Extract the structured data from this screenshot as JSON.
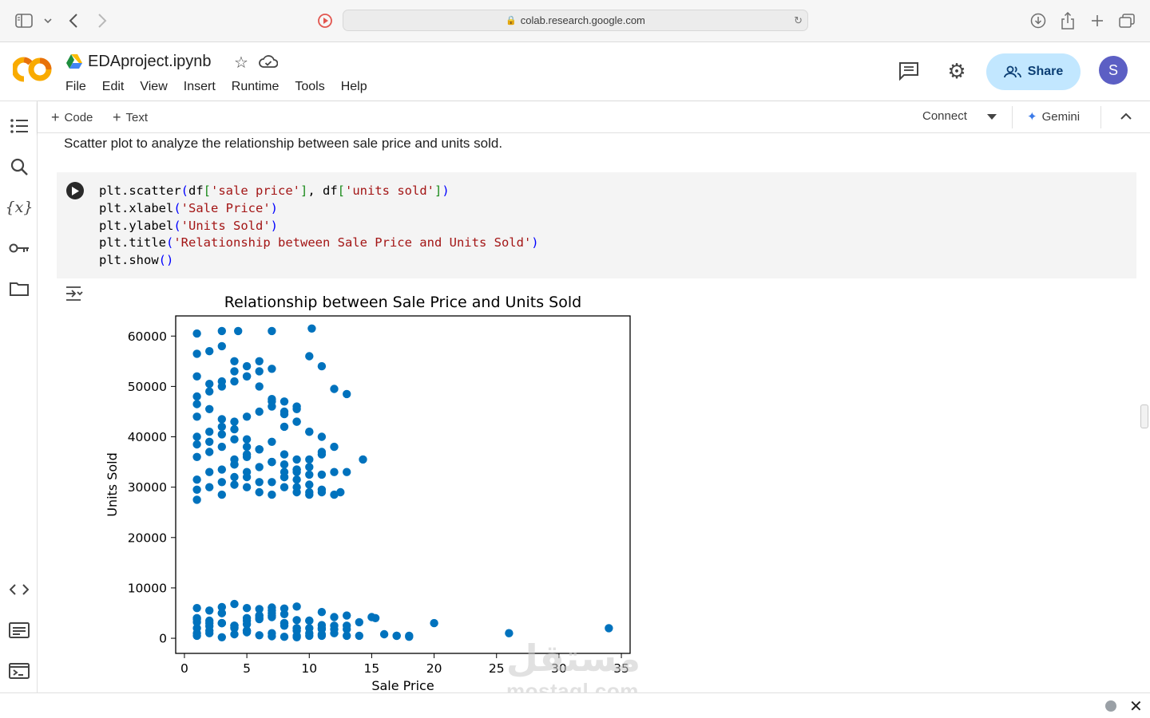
{
  "browser": {
    "url": "colab.research.google.com"
  },
  "header": {
    "notebook_title": "EDAproject.ipynb",
    "menu": [
      "File",
      "Edit",
      "View",
      "Insert",
      "Runtime",
      "Tools",
      "Help"
    ],
    "share_label": "Share",
    "avatar_initial": "S"
  },
  "toolbar": {
    "code_label": "Code",
    "text_label": "Text",
    "connect_label": "Connect",
    "gemini_label": "Gemini"
  },
  "notebook": {
    "markdown_text": "Scatter plot to analyze the relationship between sale price and units sold.",
    "code_lines": [
      "plt.scatter(df['sale price'], df['units sold'])",
      "plt.xlabel('Sale Price')",
      "plt.ylabel('Units Sold')",
      "plt.title('Relationship between Sale Price and Units Sold')",
      "plt.show()"
    ]
  },
  "watermark": {
    "latin": "mostaql.com",
    "arabic": "مستقل"
  },
  "chart_data": {
    "type": "scatter",
    "title": "Relationship between Sale Price and Units Sold",
    "xlabel": "Sale Price",
    "ylabel": "Units Sold",
    "xlim": [
      -0.7,
      35.7
    ],
    "ylim": [
      -3000,
      64000
    ],
    "xticks": [
      0,
      5,
      10,
      15,
      20,
      25,
      30,
      35
    ],
    "yticks": [
      0,
      10000,
      20000,
      30000,
      40000,
      50000,
      60000
    ],
    "grid": false,
    "color": "#0072bd",
    "x": [
      1,
      3,
      4.3,
      7,
      10.2,
      1,
      2,
      3,
      4,
      5,
      6,
      7,
      8,
      9,
      10,
      11,
      12,
      1,
      2,
      3,
      4,
      5,
      6,
      7,
      8,
      9,
      10,
      11,
      1,
      2,
      3,
      4,
      5,
      6,
      7,
      8,
      9,
      10,
      11,
      12,
      13,
      14.3,
      1,
      2,
      3,
      4,
      5,
      6,
      7,
      8,
      9,
      1,
      2,
      3,
      4,
      5,
      6,
      7,
      8,
      9,
      10,
      11,
      12,
      13,
      1,
      2,
      3,
      4,
      5,
      6,
      7,
      8,
      9,
      10,
      12,
      1,
      2,
      3,
      4,
      5,
      6,
      7,
      8,
      9,
      10,
      11,
      1,
      3,
      4,
      5,
      6,
      7,
      8,
      9,
      10,
      11,
      12.5,
      1,
      2,
      3,
      4,
      5,
      7,
      8,
      9,
      10,
      1,
      3,
      4,
      5,
      6,
      7,
      9,
      10,
      11,
      1,
      2,
      4,
      5,
      6,
      8,
      9,
      1,
      2,
      3,
      4,
      5,
      6,
      7,
      8,
      9,
      1,
      2,
      3,
      4,
      5,
      6,
      7,
      8,
      9,
      10,
      11,
      12,
      13,
      14,
      15,
      16,
      17,
      18,
      1,
      2,
      3,
      4,
      5,
      6,
      7,
      8,
      9,
      10,
      11,
      12,
      13,
      1,
      2,
      3,
      4,
      5,
      6,
      7,
      8,
      9,
      10,
      11,
      1,
      2,
      3,
      4,
      5,
      6,
      7,
      8,
      9,
      10,
      11,
      12,
      13,
      1,
      2,
      3,
      4,
      5,
      6,
      7,
      8,
      9,
      10,
      11,
      12,
      1,
      3,
      5,
      7,
      9,
      11,
      13,
      15.3,
      20,
      34,
      26,
      18,
      17,
      14
    ],
    "y": [
      60500,
      61000,
      61000,
      61000,
      61500,
      29500,
      30000,
      31000,
      32000,
      33000,
      34000,
      35000,
      30000,
      29000,
      28500,
      29000,
      28500,
      36000,
      37000,
      38000,
      35500,
      36500,
      37500,
      35000,
      34500,
      33500,
      32500,
      37000,
      40000,
      41000,
      42000,
      43000,
      44000,
      45000,
      46000,
      42000,
      43000,
      41000,
      40000,
      38000,
      33000,
      35500,
      48000,
      49000,
      50000,
      51000,
      52000,
      53000,
      53500,
      47000,
      46000,
      52000,
      50500,
      51000,
      53000,
      54000,
      55000,
      47500,
      44500,
      45500,
      56000,
      54000,
      49500,
      48500,
      56500,
      57000,
      58000,
      55000,
      52000,
      50000,
      47000,
      45000,
      43000,
      41000,
      33000,
      38500,
      39000,
      40500,
      39500,
      38000,
      37500,
      39000,
      36500,
      35500,
      34000,
      32500,
      46500,
      43500,
      41500,
      39500,
      37500,
      35000,
      33000,
      31500,
      30500,
      29500,
      29000,
      44000,
      45500,
      33500,
      34500,
      36000,
      31000,
      32000,
      30000,
      29000,
      31500,
      28500,
      30500,
      32000,
      29000,
      28500,
      33500,
      35500,
      36500,
      27500,
      33000,
      34500,
      30000,
      31000,
      32000,
      33000,
      6000,
      5500,
      6200,
      6800,
      6000,
      5800,
      6100,
      5900,
      6300,
      2000,
      1500,
      3000,
      2500,
      3500,
      4000,
      4500,
      3000,
      2000,
      1000,
      500,
      2500,
      1800,
      3200,
      4200,
      800,
      500,
      300,
      4000,
      3500,
      5000,
      2500,
      1500,
      4500,
      5000,
      3000,
      2000,
      3500,
      2000,
      1000,
      500,
      500,
      1000,
      200,
      800,
      1200,
      600,
      400,
      300,
      200,
      500,
      800,
      1000,
      2400,
      3000,
      2200,
      2800,
      3800,
      4200,
      2500,
      1500,
      2000,
      2600,
      1800,
      4500,
      3200,
      3000,
      5000,
      2000,
      4000,
      4500,
      5500,
      4800,
      3600,
      3500,
      5200,
      4200,
      3800,
      3000,
      1500,
      1000,
      500,
      1800,
      2500,
      4000,
      3000,
      2000,
      1000,
      500,
      500,
      500,
      6000,
      6200,
      4500,
      3500
    ]
  }
}
